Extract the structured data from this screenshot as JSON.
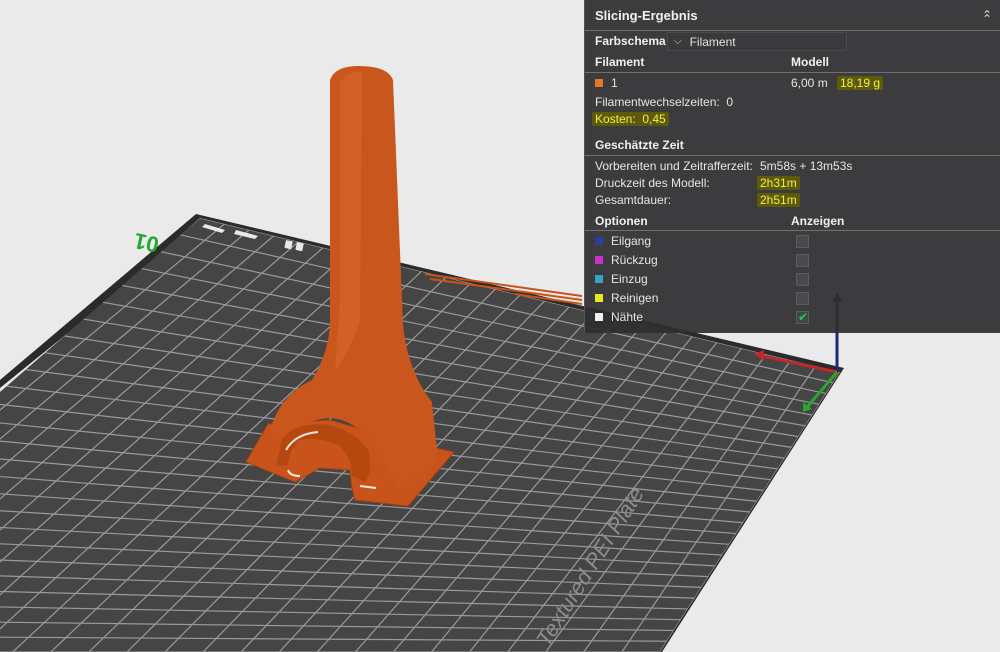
{
  "viewport": {
    "plate_label": "Textured PEI Plate",
    "plate_number": "01",
    "model_color": "#c8541b",
    "plate_color": "#444444"
  },
  "panel": {
    "title": "Slicing-Ergebnis",
    "collapse_icon": "chevron-up-double-icon",
    "color_scheme": {
      "label": "Farbschema",
      "selected": "Filament"
    },
    "filament_table": {
      "col1": "Filament",
      "col2": "Modell",
      "rows": [
        {
          "id": "1",
          "color": "#e87722",
          "length": "6,00 m",
          "weight": "18,19 g"
        }
      ]
    },
    "filament_changes": {
      "label": "Filamentwechselzeiten:",
      "value": "0"
    },
    "cost": {
      "label": "Kosten:",
      "value": "0,45"
    },
    "time": {
      "heading": "Geschätzte Zeit",
      "prepare": {
        "label": "Vorbereiten und Zeitrafferzeit:",
        "value": "5m58s + 13m53s"
      },
      "print": {
        "label": "Druckzeit des Modell:",
        "value": "2h31m"
      },
      "total": {
        "label": "Gesamtdauer:",
        "value": "2h51m"
      }
    },
    "options": {
      "col1": "Optionen",
      "col2": "Anzeigen",
      "items": [
        {
          "label": "Eilgang",
          "color": "#2c3f9c",
          "checked": false
        },
        {
          "label": "Rückzug",
          "color": "#c832c8",
          "checked": false
        },
        {
          "label": "Einzug",
          "color": "#3aa0c8",
          "checked": false
        },
        {
          "label": "Reinigen",
          "color": "#e8e81c",
          "checked": false
        },
        {
          "label": "Nähte",
          "color": "#f0f0f0",
          "checked": true
        }
      ]
    }
  }
}
